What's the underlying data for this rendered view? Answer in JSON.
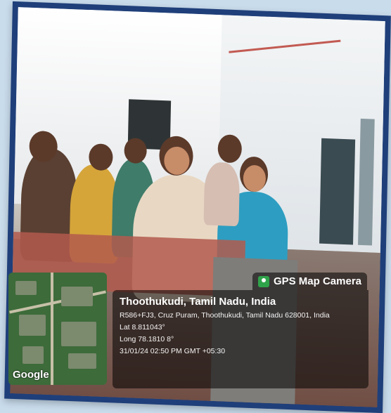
{
  "overlay": {
    "badge_label": "GPS Map Camera",
    "location_title": "Thoothukudi, Tamil Nadu, India",
    "address": "R586+FJ3, Cruz Puram, Thoothukudi, Tamil Nadu 628001, India",
    "lat": "Lat 8.811043°",
    "long": "Long 78.1810 8°",
    "datetime": "31/01/24 02:50 PM GMT +05:30",
    "map_logo": "Google",
    "badge_color": "#2fa34a"
  }
}
